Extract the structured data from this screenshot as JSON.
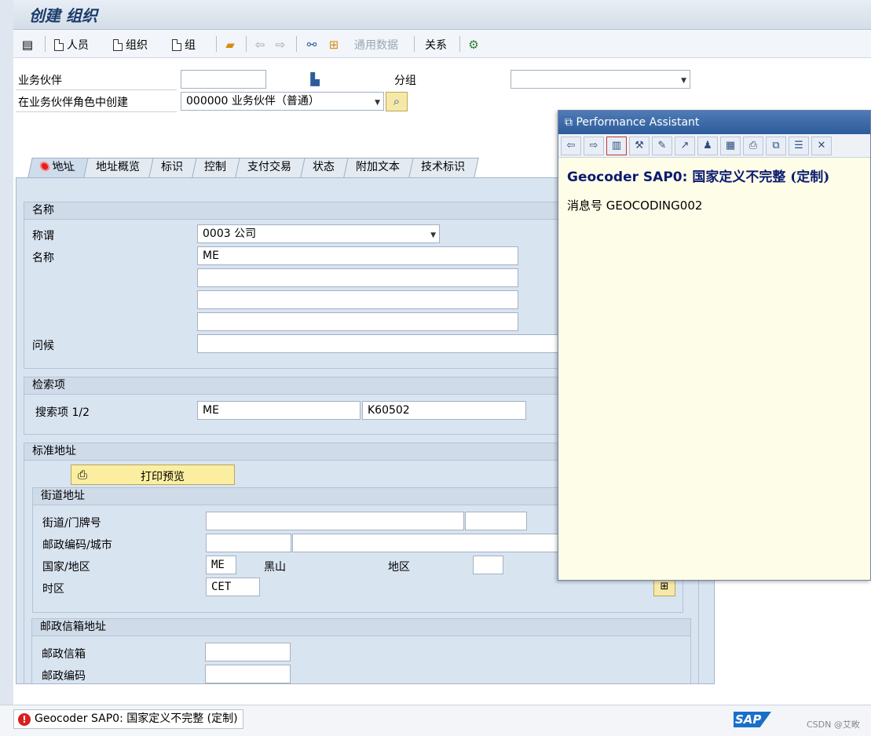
{
  "window": {
    "title": "创建 组织"
  },
  "toolbar": {
    "person_label": "人员",
    "organization_label": "组织",
    "group_label": "组",
    "general_data_label": "通用数据",
    "relations_label": "关系"
  },
  "header": {
    "bp_label": "业务伙伴",
    "bp_value": "",
    "grouping_label": "分组",
    "grouping_value": "",
    "role_label": "在业务伙伴角色中创建",
    "role_value": "000000 业务伙伴（普通）"
  },
  "tabs": [
    {
      "label": "地址"
    },
    {
      "label": "地址概览"
    },
    {
      "label": "标识"
    },
    {
      "label": "控制"
    },
    {
      "label": "支付交易"
    },
    {
      "label": "状态"
    },
    {
      "label": "附加文本"
    },
    {
      "label": "技术标识"
    }
  ],
  "name_section": {
    "title": "名称",
    "salutation_label": "称谓",
    "salutation_value": "0003 公司",
    "name_label": "名称",
    "name_values": [
      "ME",
      "",
      "",
      ""
    ],
    "greeting_label": "问候",
    "greeting_value": ""
  },
  "search_section": {
    "title": "检索项",
    "label": "搜索项 1/2",
    "term1": "ME",
    "term2": "K60502"
  },
  "address_section": {
    "title": "标准地址",
    "print_preview_label": "打印预览",
    "street_group_title": "街道地址",
    "street_label": "街道/门牌号",
    "street_value": "",
    "house_no_value": "",
    "postal_city_label": "邮政编码/城市",
    "postal_value": "",
    "city_value": "",
    "country_label": "国家/地区",
    "country_code": "ME",
    "country_name": "黑山",
    "region_label": "地区",
    "region_value": "",
    "timezone_label": "时区",
    "timezone_value": "CET"
  },
  "pobox_section": {
    "title": "邮政信箱地址",
    "pobox_label": "邮政信箱",
    "pobox_value": "",
    "postal_label": "邮政编码",
    "postal_value": ""
  },
  "performance_assistant": {
    "title": "Performance Assistant",
    "heading_bold": "Geocoder SAP0:",
    "heading_rest": " 国家定义不完整 (定制)",
    "message": "消息号 GEOCODING002"
  },
  "status": {
    "message": "Geocoder SAP0: 国家定义不完整 (定制)",
    "logo": "SAP",
    "watermark": "CSDN @艾畋"
  }
}
